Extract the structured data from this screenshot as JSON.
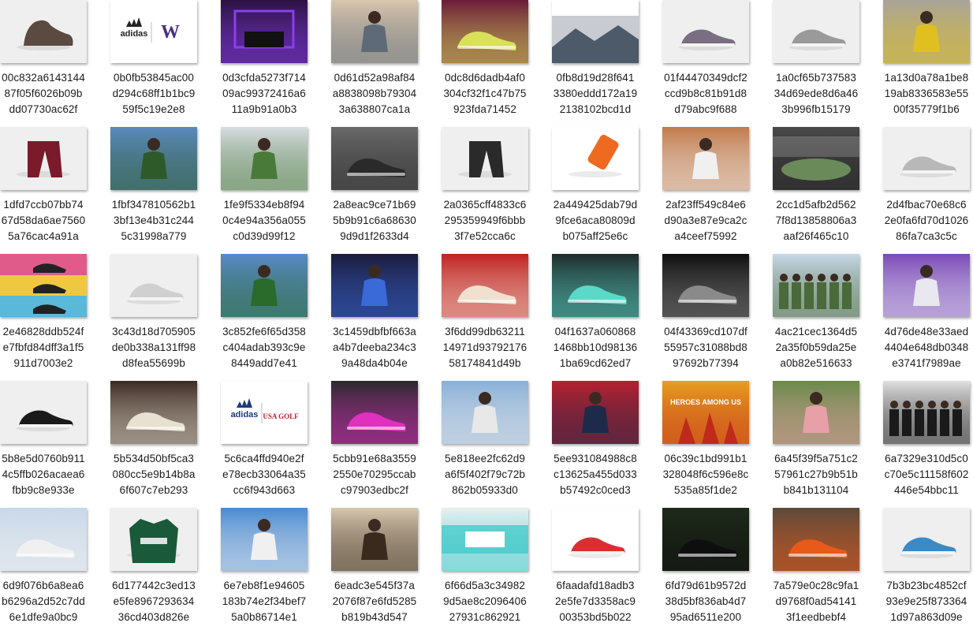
{
  "files": [
    {
      "name": [
        "00c832a6143144",
        "87f05f6026b09b",
        "dd07730ac62f"
      ],
      "thumb": {
        "kind": "product",
        "bg": "#efefef",
        "fg": "#5a4a40",
        "icon": "boot-icon"
      }
    },
    {
      "name": [
        "0b0fb53845ac00",
        "d294c68ff1b1bc9",
        "59f5c19e2e8"
      ],
      "thumb": {
        "kind": "logo",
        "bg": "#ffffff",
        "fg": "#222222",
        "accent": "#4b2e83",
        "text": "adidas",
        "text2": "W",
        "icon": "adidas-washington-logo"
      }
    },
    {
      "name": [
        "0d3cfda5273f714",
        "09ac99372416a6",
        "11a9b91a0b3"
      ],
      "thumb": {
        "kind": "scene",
        "bg": "#2a1240",
        "fg": "#8b3df0",
        "icon": "room-icon"
      }
    },
    {
      "name": [
        "0d61d52a98af84",
        "a8838098b79304",
        "3a638807ca1a"
      ],
      "thumb": {
        "kind": "scene",
        "bg": "#d9c7ae",
        "fg": "#5e6a78",
        "icon": "person-sofa-icon"
      }
    },
    {
      "name": [
        "0dc8d6dadb4af0",
        "304cf32f1c47b75",
        "923fda71452"
      ],
      "thumb": {
        "kind": "scene",
        "bg": "#6a1b3a",
        "fg": "#d9e05a",
        "icon": "sneakers-icon"
      }
    },
    {
      "name": [
        "0fb8d19d28f641",
        "3380eddd172a19",
        "2138102bcd1d"
      ],
      "thumb": {
        "kind": "scene",
        "bg": "#ffffff",
        "fg": "#4c5a6a",
        "icon": "winter-scene-icon"
      }
    },
    {
      "name": [
        "01f44470349dcf2",
        "ccd9b8c81b91d8",
        "d79abc9f688"
      ],
      "thumb": {
        "kind": "product",
        "bg": "#efefef",
        "fg": "#7a6e82",
        "icon": "sneaker-icon"
      }
    },
    {
      "name": [
        "1a0cf65b737583",
        "34d69ede8d6a46",
        "3b996fb15179"
      ],
      "thumb": {
        "kind": "product",
        "bg": "#efefef",
        "fg": "#9a9a9a",
        "icon": "sneaker-icon"
      }
    },
    {
      "name": [
        "1a13d0a78a1be8",
        "19ab8336583e55",
        "00f35779f1b6"
      ],
      "thumb": {
        "kind": "scene",
        "bg": "#a8a39a",
        "fg": "#e0c020",
        "icon": "person-icon"
      }
    },
    {
      "name": [
        "1dfd7ccb07bb74",
        "67d58da6ae7560",
        "5a76cac4a91a"
      ],
      "thumb": {
        "kind": "product",
        "bg": "#efefef",
        "fg": "#7a1a2a",
        "icon": "pants-icon"
      }
    },
    {
      "name": [
        "1fbf347810562b1",
        "3bf13e4b31c244",
        "5c31998a779"
      ],
      "thumb": {
        "kind": "scene",
        "bg": "#5c8ac0",
        "fg": "#2e5a2a",
        "icon": "golfer-icon"
      }
    },
    {
      "name": [
        "1fe9f5334eb8f94",
        "0c4e94a356a055",
        "c0d39d99f12"
      ],
      "thumb": {
        "kind": "scene",
        "bg": "#d8dde2",
        "fg": "#4a7a3a",
        "icon": "golfer-icon"
      }
    },
    {
      "name": [
        "2a8eac9ce71b69",
        "5b9b91c6a68630",
        "9d9d1f2633d4"
      ],
      "thumb": {
        "kind": "scene",
        "bg": "#6a6a6a",
        "fg": "#2a2a2a",
        "icon": "legs-sneakers-icon"
      }
    },
    {
      "name": [
        "2a0365cff4833c6",
        "295359949f6bbb",
        "3f7e52cca6c"
      ],
      "thumb": {
        "kind": "product",
        "bg": "#efefef",
        "fg": "#2a2a2a",
        "icon": "pants-icon"
      }
    },
    {
      "name": [
        "2a449425dab79d",
        "9fce6aca80809d",
        "b075aff25e6c"
      ],
      "thumb": {
        "kind": "product",
        "bg": "#ffffff",
        "fg": "#ee6a20",
        "icon": "bottle-icon"
      }
    },
    {
      "name": [
        "2af23ff549c84e6",
        "d90a3e87e9ca2c",
        "a4ceef75992"
      ],
      "thumb": {
        "kind": "scene",
        "bg": "#c07a4a",
        "fg": "#f0f0f0",
        "icon": "tennis-icon"
      }
    },
    {
      "name": [
        "2cc1d5afb2d562",
        "7f8d13858806a3",
        "aaf26f465c10"
      ],
      "thumb": {
        "kind": "scene",
        "bg": "#4a4a4a",
        "fg": "#1e1e1e",
        "icon": "stadium-icon"
      }
    },
    {
      "name": [
        "2d4fbac70e68c6",
        "2e0fa6fd70d1026",
        "86fa7ca3c5c"
      ],
      "thumb": {
        "kind": "product",
        "bg": "#efefef",
        "fg": "#b8b8b8",
        "icon": "sneaker-icon"
      }
    },
    {
      "name": [
        "2e46828ddb524f",
        "e7fbfd84dff3a1f5",
        "911d7003e2"
      ],
      "thumb": {
        "kind": "bands",
        "bg": "#f0c840",
        "fg": "#e05a8a",
        "accent": "#5ab8d8",
        "icon": "sneakers-collage-icon"
      }
    },
    {
      "name": [
        "3c43d18d705905",
        "de0b338a131ff98",
        "d8fea55699b"
      ],
      "thumb": {
        "kind": "product",
        "bg": "#efefef",
        "fg": "#d0d0d0",
        "icon": "sneaker-icon"
      }
    },
    {
      "name": [
        "3c852fe6f65d358",
        "c404adab393c9e",
        "8449add7e41"
      ],
      "thumb": {
        "kind": "scene",
        "bg": "#5a8ac8",
        "fg": "#2a6a2a",
        "icon": "athlete-icon"
      }
    },
    {
      "name": [
        "3c1459dbfbf663a",
        "a4b7deeba234c3",
        "9a48da4b04e"
      ],
      "thumb": {
        "kind": "scene",
        "bg": "#1a1a3a",
        "fg": "#3a6ad8",
        "icon": "person-icon"
      }
    },
    {
      "name": [
        "3f6dd99db63211",
        "14971d93792176",
        "58174841d49b"
      ],
      "thumb": {
        "kind": "scene",
        "bg": "#c02020",
        "fg": "#f0e0d0",
        "icon": "sneakers-icon"
      }
    },
    {
      "name": [
        "04f1637a060868",
        "1468bb10d98136",
        "1ba69cd62ed7"
      ],
      "thumb": {
        "kind": "scene",
        "bg": "#1e2a2a",
        "fg": "#5ad8c8",
        "icon": "cleat-icon"
      }
    },
    {
      "name": [
        "04f43369cd107df",
        "55957c31088bd8",
        "97692b77394"
      ],
      "thumb": {
        "kind": "scene",
        "bg": "#0e0e0e",
        "fg": "#8a8a8a",
        "icon": "sneaker-icon"
      }
    },
    {
      "name": [
        "4ac21cec1364d5",
        "2a35f0b59da25e",
        "a0b82e516633"
      ],
      "thumb": {
        "kind": "scene",
        "bg": "#c8d8e8",
        "fg": "#4a6a3a",
        "icon": "group-icon"
      }
    },
    {
      "name": [
        "4d76de48e33aed",
        "4404e648db0348",
        "e3741f7989ae"
      ],
      "thumb": {
        "kind": "scene",
        "bg": "#7a4ab8",
        "fg": "#e8e8f0",
        "icon": "person-icon"
      }
    },
    {
      "name": [
        "5b8e5d0760b911",
        "4c5ffb026acaea6",
        "fbb9c8e933e"
      ],
      "thumb": {
        "kind": "product",
        "bg": "#efefef",
        "fg": "#1a1a1a",
        "icon": "sneaker-icon"
      }
    },
    {
      "name": [
        "5b534d50bf5ca3",
        "080cc5e9b14b8a",
        "6f607c7eb293"
      ],
      "thumb": {
        "kind": "scene",
        "bg": "#3a2a22",
        "fg": "#e8e0d0",
        "icon": "sneaker-icon"
      }
    },
    {
      "name": [
        "5c6ca4ffd940e2f",
        "e78ecb33064a35",
        "cc6f943d663"
      ],
      "thumb": {
        "kind": "logo",
        "bg": "#ffffff",
        "fg": "#1e3a7a",
        "accent": "#c82030",
        "text": "adidas",
        "text2": "USA GOLF",
        "icon": "adidas-usa-golf-logo"
      }
    },
    {
      "name": [
        "5cbb91e68a3559",
        "2550e70295ccab",
        "c97903edbc2f"
      ],
      "thumb": {
        "kind": "scene",
        "bg": "#2a2a2e",
        "fg": "#e030c0",
        "icon": "cleat-icon"
      }
    },
    {
      "name": [
        "5e818ee2fc62d9",
        "a6f5f402f79c72b",
        "862b05933d0"
      ],
      "thumb": {
        "kind": "scene",
        "bg": "#8ab0d8",
        "fg": "#e8e8e8",
        "icon": "person-icon"
      }
    },
    {
      "name": [
        "5ee931084988c8",
        "c13625a455d033",
        "b57492c0ced3"
      ],
      "thumb": {
        "kind": "scene",
        "bg": "#b82030",
        "fg": "#1e2a4a",
        "icon": "person-icon"
      }
    },
    {
      "name": [
        "06c39c1bd991b1",
        "328048f6c596e8c",
        "535a85f1de2"
      ],
      "thumb": {
        "kind": "scene",
        "bg": "#e8a020",
        "fg": "#c02a1a",
        "text": "HEROES AMONG US",
        "icon": "poster-icon"
      }
    },
    {
      "name": [
        "6a45f39f5a751c2",
        "57961c27b9b51b",
        "b841b131104"
      ],
      "thumb": {
        "kind": "scene",
        "bg": "#6a8a4a",
        "fg": "#e8a0a8",
        "icon": "golfer-icon"
      }
    },
    {
      "name": [
        "6a7329e310d5c0",
        "c70e5c11158f602",
        "446e54bbc11"
      ],
      "thumb": {
        "kind": "scene",
        "bg": "#e0e0e0",
        "fg": "#1a1a1a",
        "icon": "group-icon"
      }
    },
    {
      "name": [
        "6d9f076b6a8ea6",
        "b6296a2d52c7dd",
        "6e1dfe9a0bc9"
      ],
      "thumb": {
        "kind": "scene",
        "bg": "#c8d8e8",
        "fg": "#f0f0f0",
        "icon": "sneakers-icon"
      }
    },
    {
      "name": [
        "6d177442c3ed13",
        "e5fe8967293634",
        "36cd403d826e"
      ],
      "thumb": {
        "kind": "product",
        "bg": "#efefef",
        "fg": "#1a5a3a",
        "icon": "jacket-icon"
      }
    },
    {
      "name": [
        "6e7eb8f1e94605",
        "183b74e2f34bef7",
        "5a0b86714e1"
      ],
      "thumb": {
        "kind": "scene",
        "bg": "#4a8ad0",
        "fg": "#f0f0f0",
        "icon": "tennis-icon"
      }
    },
    {
      "name": [
        "6eadc3e545f37a",
        "2076f87e6fd5285",
        "b819b43d547"
      ],
      "thumb": {
        "kind": "scene",
        "bg": "#d8c8b0",
        "fg": "#3a2a1e",
        "icon": "athlete-icon"
      }
    },
    {
      "name": [
        "6f66d5a3c34982",
        "9d5ae8c2096406",
        "27931c862921"
      ],
      "thumb": {
        "kind": "scene",
        "bg": "#e8f0f0",
        "fg": "#3ac8c8",
        "icon": "banner-icon"
      }
    },
    {
      "name": [
        "6faadafd18adb3",
        "2e5fe7d3358ac9",
        "00353bd5b022"
      ],
      "thumb": {
        "kind": "product",
        "bg": "#ffffff",
        "fg": "#d83030",
        "icon": "sneaker-icon"
      }
    },
    {
      "name": [
        "6fd79d61b9572d",
        "38d5bf836ab4d7",
        "95ad6511e200"
      ],
      "thumb": {
        "kind": "scene",
        "bg": "#1e2a1a",
        "fg": "#0e0e0e",
        "icon": "sneaker-icon"
      }
    },
    {
      "name": [
        "7a579e0c28c9fa1",
        "d9768f0ad54141",
        "3f1eedbebf4"
      ],
      "thumb": {
        "kind": "scene",
        "bg": "#5a4a3a",
        "fg": "#e85a1a",
        "icon": "basketball-icon"
      }
    },
    {
      "name": [
        "7b3b23bc4852cf",
        "93e9e25f873364",
        "1d97a863d09e"
      ],
      "thumb": {
        "kind": "product",
        "bg": "#efefef",
        "fg": "#3a8ac8",
        "icon": "sneaker-icon"
      }
    }
  ]
}
